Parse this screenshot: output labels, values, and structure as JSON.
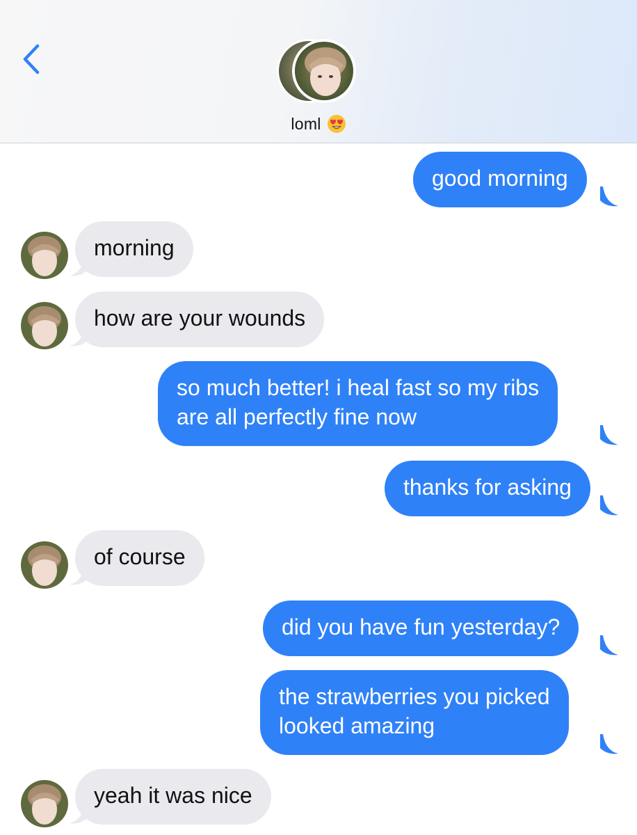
{
  "header": {
    "contact_name": "loml",
    "back_icon": "chevron-left-icon",
    "emoji": "heart-eyes-emoji",
    "accent_color": "#2f81f7"
  },
  "messages": [
    {
      "from": "me",
      "text": "good morning"
    },
    {
      "from": "them",
      "text": "morning"
    },
    {
      "from": "them",
      "text": "how are your wounds"
    },
    {
      "from": "me",
      "lines": [
        "so much better! i heal fast so my ribs",
        "are all perfectly fine now"
      ]
    },
    {
      "from": "me",
      "text": "thanks for asking"
    },
    {
      "from": "them",
      "text": "of course"
    },
    {
      "from": "me",
      "text": "did you have fun yesterday?"
    },
    {
      "from": "me",
      "lines": [
        "the strawberries you picked",
        "looked amazing"
      ]
    },
    {
      "from": "them",
      "text": "yeah it was nice"
    }
  ]
}
